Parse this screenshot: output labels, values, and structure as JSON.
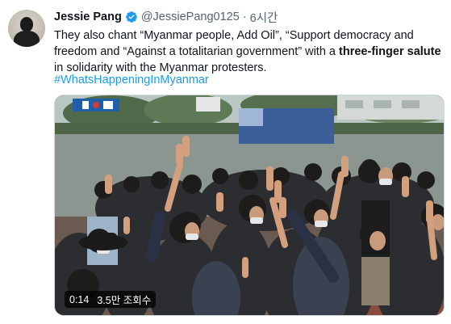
{
  "tweet": {
    "author_name": "Jessie Pang",
    "handle": "@JessiePang0125",
    "separator": "·",
    "time": "6시간",
    "text_before_bold": "They also chant “Myanmar people, Add Oil”, “Support democracy and freedom and “Against a totalitarian government” with a ",
    "text_bold": "three-finger salute",
    "text_after_bold": " in solidarity with the Myanmar protesters.",
    "hashtag": "#WhatsHappeningInMyanmar"
  },
  "media": {
    "video_duration": "0:14",
    "view_count": "3.5만 조회수"
  },
  "colors": {
    "link": "#1d9bf0",
    "verified": "#1d9bf0",
    "secondary_text": "#536471"
  },
  "icons": {
    "verified": "verified-badge-icon"
  }
}
